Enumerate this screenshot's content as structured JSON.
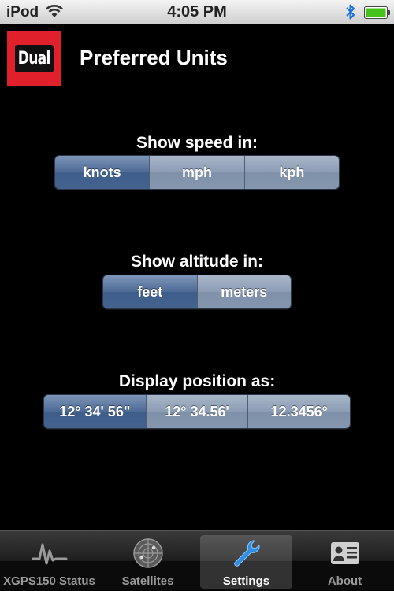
{
  "status_bar": {
    "carrier": "iPod",
    "time": "4:05 PM",
    "icons": [
      "wifi-icon",
      "bluetooth-icon",
      "battery-icon"
    ]
  },
  "header": {
    "logo_text": "Dual",
    "title": "Preferred Units"
  },
  "speed": {
    "label": "Show speed in:",
    "options": [
      "knots",
      "mph",
      "kph"
    ],
    "selected": "knots"
  },
  "altitude": {
    "label": "Show altitude in:",
    "options": [
      "feet",
      "meters"
    ],
    "selected": "feet"
  },
  "position": {
    "label": "Display position as:",
    "options": [
      "12° 34' 56\"",
      "12° 34.56'",
      "12.3456°"
    ],
    "selected": "12° 34' 56\""
  },
  "tab_bar": {
    "tabs": [
      {
        "label": "XGPS150 Status",
        "icon": "signal-wave-icon"
      },
      {
        "label": "Satellites",
        "icon": "radar-icon"
      },
      {
        "label": "Settings",
        "icon": "wrench-icon"
      },
      {
        "label": "About",
        "icon": "contact-card-icon"
      }
    ],
    "active": "Settings"
  },
  "colors": {
    "logo_red": "#e0212b",
    "segment_selected": "#45638f",
    "segment_normal": "#8b9cb4",
    "settings_icon_blue": "#2f8de4"
  }
}
